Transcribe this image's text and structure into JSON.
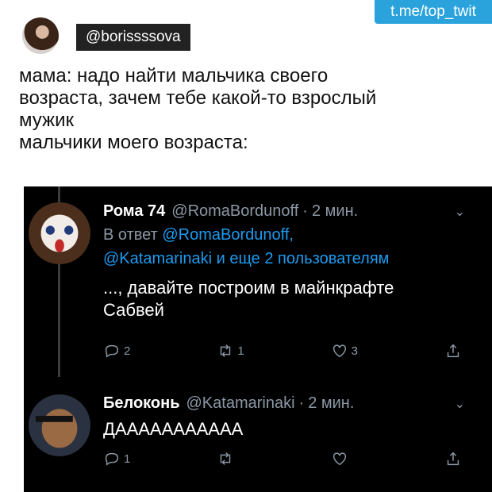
{
  "watermark": "t.me/top_twit",
  "poster": {
    "username": "@borissssova"
  },
  "caption": {
    "lines": [
      "мама: надо найти мальчика своего",
      "возраста, зачем тебе какой-то взрослый",
      "мужик",
      "мальчики моего возраста:"
    ]
  },
  "tweets": [
    {
      "name": "Рома 74",
      "handle": "@RomaBordunoff",
      "separator": "·",
      "time": "2 мин.",
      "reply_prefix": "В ответ",
      "reply_handle_1": "@RomaBordunoff,",
      "reply_handle_2": "@Katamarinaki",
      "reply_suffix": "и еще 2 пользователям",
      "text_line_1": "..., давайте построим в майнкрафте",
      "text_line_2": "Сабвей",
      "replies": "2",
      "retweets": "1",
      "likes": "3"
    },
    {
      "name": "Белоконь",
      "handle": "@Katamarinaki",
      "separator": "·",
      "time": "2 мин.",
      "text_line_1": "ДААААААААААА",
      "replies": "1",
      "retweets": "",
      "likes": ""
    }
  ],
  "icons": {
    "reply": "reply-icon",
    "retweet": "retweet-icon",
    "like": "heart-icon",
    "share": "share-icon",
    "more": "chevron-down-icon"
  },
  "colors": {
    "panel_bg": "#000000",
    "link": "#1d9bf0",
    "muted": "#8b98a5",
    "watermark_bg": "#2aa3dc"
  }
}
